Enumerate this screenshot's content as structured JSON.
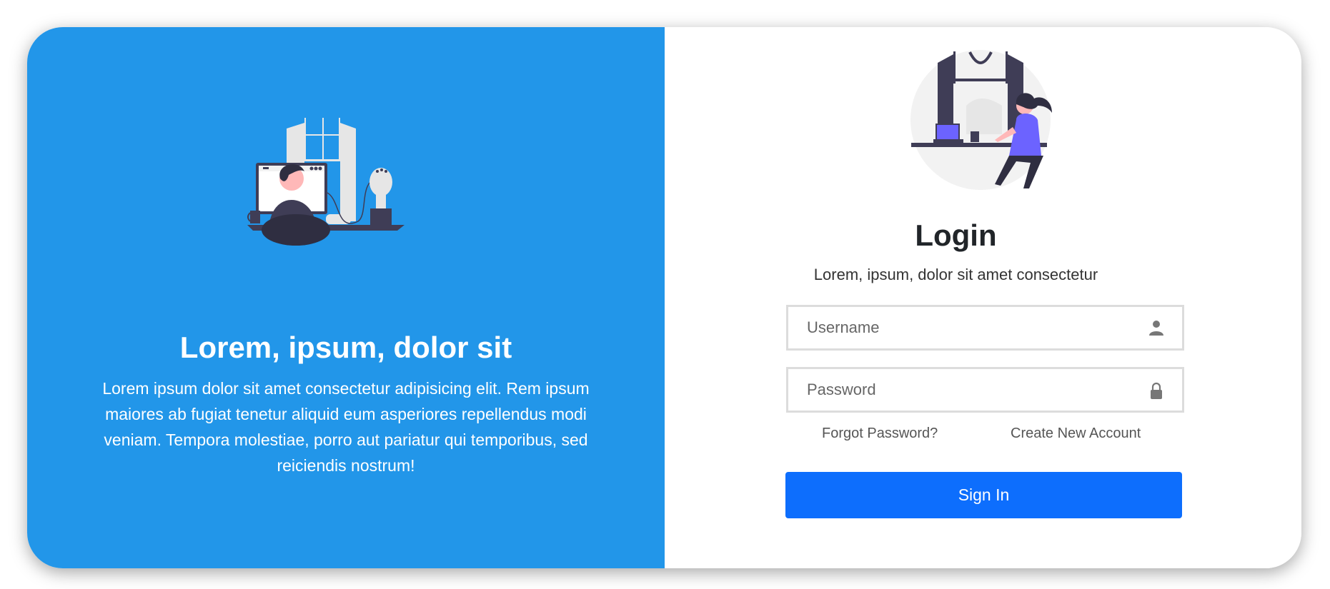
{
  "hero": {
    "illustration": "developer-at-desk-illustration",
    "title": "Lorem, ipsum, dolor sit",
    "text": "Lorem ipsum dolor sit amet consectetur adipisicing elit. Rem ipsum maiores ab fugiat tenetur aliquid eum asperiores repellendus modi veniam. Tempora molestiae, porro aut pariatur qui temporibus, sed reiciendis nostrum!"
  },
  "login": {
    "illustration": "woman-working-at-window-illustration",
    "title": "Login",
    "subtitle": "Lorem, ipsum, dolor sit amet consectetur",
    "username": {
      "value": "",
      "placeholder": "Username",
      "icon": "user-icon"
    },
    "password": {
      "value": "",
      "placeholder": "Password",
      "icon": "lock-icon"
    },
    "forgot_label": "Forgot Password?",
    "create_label": "Create New Account",
    "signin_label": "Sign In"
  },
  "colors": {
    "hero_background": "#2296e9",
    "primary_button": "#0d6efd",
    "illustration_dark": "#3f3d56",
    "illustration_accent": "#6c63ff"
  }
}
